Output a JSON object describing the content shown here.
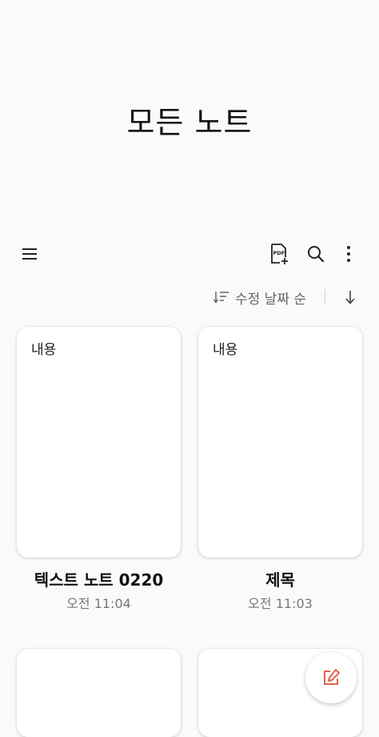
{
  "page": {
    "title": "모든 노트"
  },
  "toolbar": {
    "menu_icon": "hamburger-menu-icon",
    "pdf_icon": "pdf-import-icon",
    "search_icon": "search-icon",
    "more_icon": "more-vert-icon"
  },
  "sort": {
    "label": "수정 날짜 순",
    "sort_icon": "sort-lines-icon",
    "direction_icon": "arrow-down-icon"
  },
  "notes": [
    {
      "preview": "내용",
      "title": "텍스트 노트 0220",
      "time": "오전 11:04"
    },
    {
      "preview": "내용",
      "title": "제목",
      "time": "오전 11:03"
    },
    {
      "preview": "",
      "title": "",
      "time": ""
    },
    {
      "preview": "",
      "title": "",
      "time": ""
    }
  ],
  "fab": {
    "icon": "new-note-pen-icon",
    "accent_color": "#e0664a"
  }
}
